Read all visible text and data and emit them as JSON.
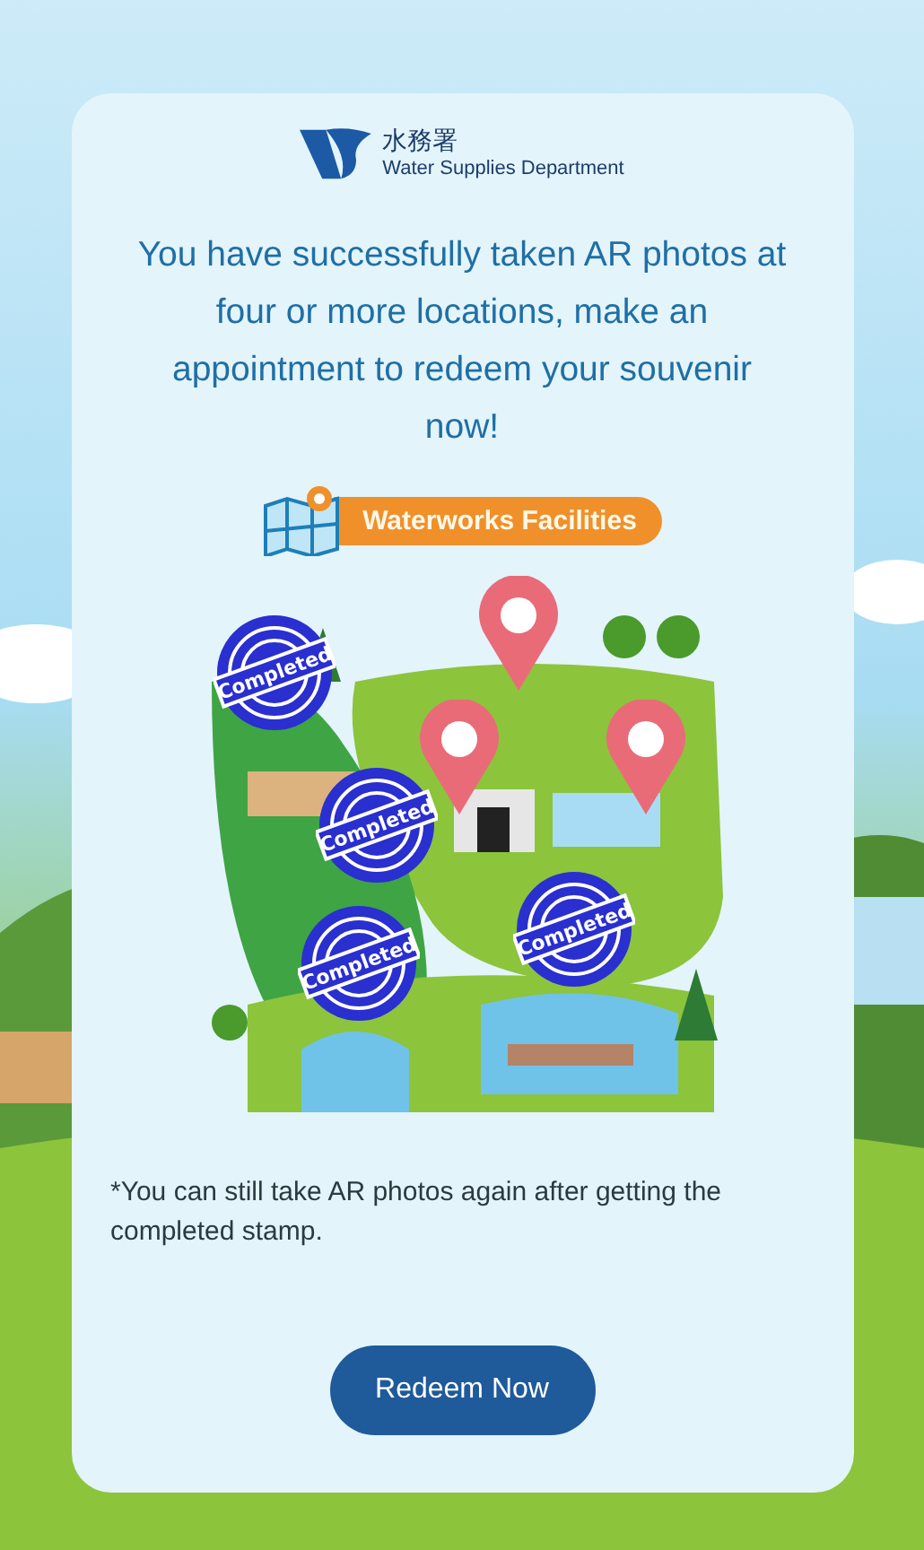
{
  "logo": {
    "chinese": "水務署",
    "english": "Water Supplies Department"
  },
  "message": "You have successfully taken AR photos at four or more locations, make an appointment to redeem your souvenir now!",
  "banner": {
    "label": "Waterworks Facilities"
  },
  "locations": [
    {
      "completed": true,
      "stamp": "Completed"
    },
    {
      "completed": true,
      "stamp": "Completed"
    },
    {
      "completed": true,
      "stamp": "Completed"
    },
    {
      "completed": true,
      "stamp": "Completed"
    },
    {
      "completed": false
    },
    {
      "completed": false
    },
    {
      "completed": false
    }
  ],
  "note": "*You can still take AR photos again after getting the completed stamp.",
  "button": "Redeem Now"
}
